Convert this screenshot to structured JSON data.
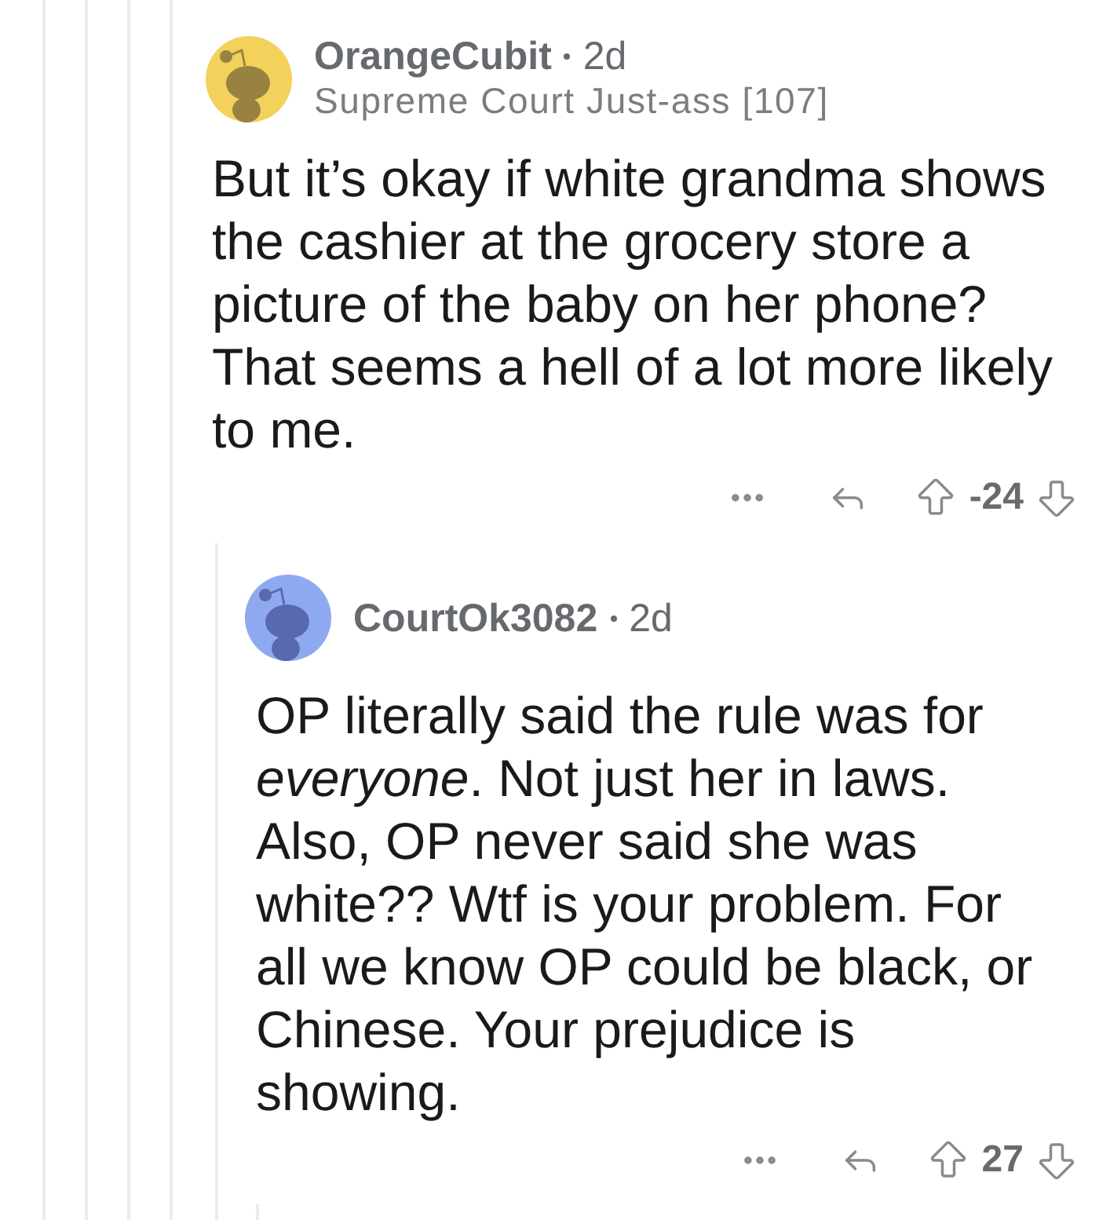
{
  "comments": [
    {
      "username": "OrangeCubit",
      "age": "2d",
      "flair": "Supreme Court Just-ass [107]",
      "color": "#f3d15a",
      "body": "But it’s okay if white grandma shows the cashier at the grocery store a picture of the baby on her phone? That seems a hell of a lot more likely to me.",
      "score": "-24",
      "children": [
        {
          "username": "CourtOk3082",
          "age": "2d",
          "color": "#8fa9f1",
          "body": "OP literally said the rule was for *everyone*. Not just her in laws. Also, OP never said she was white?? Wtf is your problem. For all we know OP could be black, or Chinese. Your prejudice is showing.",
          "score": "27"
        }
      ]
    }
  ]
}
